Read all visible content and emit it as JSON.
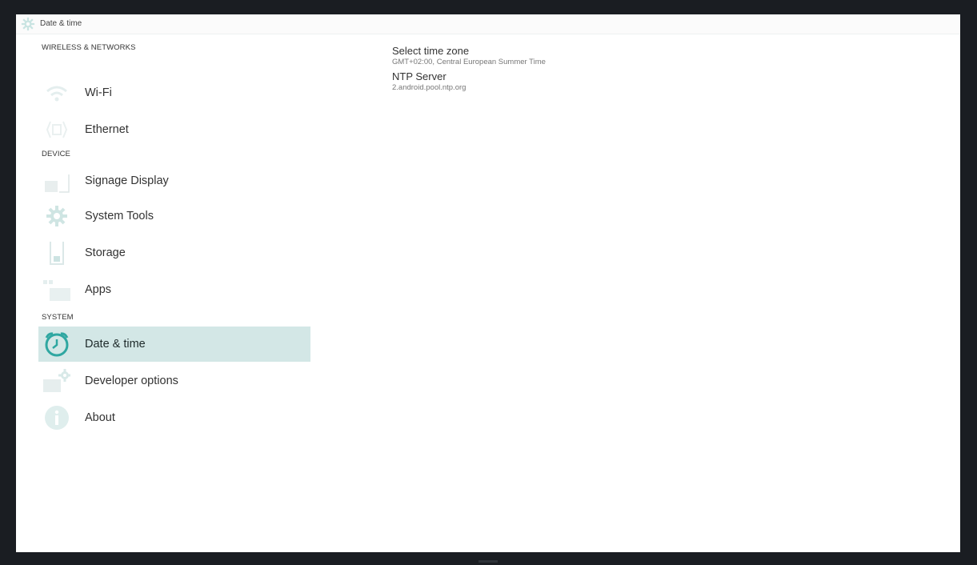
{
  "actionbar": {
    "title": "Date & time",
    "icon": "gear-icon"
  },
  "sidebar": {
    "sections": [
      {
        "header": "WIRELESS & NETWORKS"
      },
      {
        "header": "DEVICE"
      },
      {
        "header": "SYSTEM"
      }
    ],
    "items": [
      {
        "label": "Wi-Fi",
        "icon": "wifi-icon"
      },
      {
        "label": "Ethernet",
        "icon": "ethernet-icon"
      },
      {
        "label": "Signage Display",
        "icon": "display-icon"
      },
      {
        "label": "System Tools",
        "icon": "gear-icon"
      },
      {
        "label": "Storage",
        "icon": "storage-icon"
      },
      {
        "label": "Apps",
        "icon": "apps-icon"
      },
      {
        "label": "Date & time",
        "icon": "clock-icon",
        "selected": true
      },
      {
        "label": "Developer options",
        "icon": "developer-icon"
      },
      {
        "label": "About",
        "icon": "info-icon"
      }
    ]
  },
  "detail": {
    "prefs": [
      {
        "title": "Select time zone",
        "summary": "GMT+02:00, Central European Summer Time"
      },
      {
        "title": "NTP Server",
        "summary": "2.android.pool.ntp.org"
      }
    ]
  },
  "colors": {
    "accent": "#2fa7a1",
    "selected_bg": "#d3e7e6",
    "icon_muted": "#c9e4e2"
  }
}
